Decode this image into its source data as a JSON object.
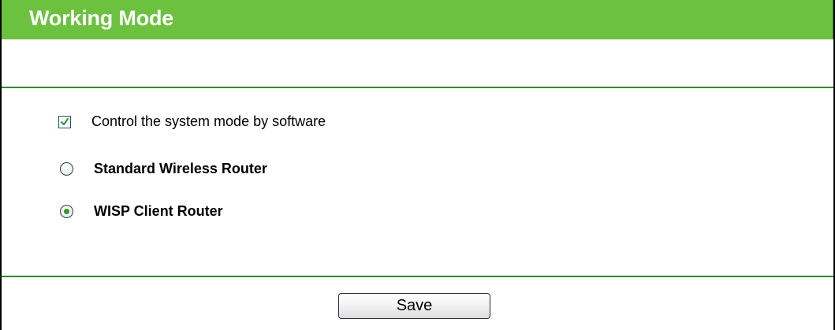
{
  "header": {
    "title": "Working Mode"
  },
  "options": {
    "software_control": {
      "label": "Control the system mode by software",
      "checked": true
    },
    "modes": [
      {
        "label": "Standard Wireless Router",
        "selected": false
      },
      {
        "label": "WISP Client Router",
        "selected": true
      }
    ]
  },
  "actions": {
    "save_label": "Save"
  },
  "colors": {
    "title_bar": "#6cc23e",
    "divider": "#2f8a2f",
    "radio_dot": "#2a9a28"
  }
}
